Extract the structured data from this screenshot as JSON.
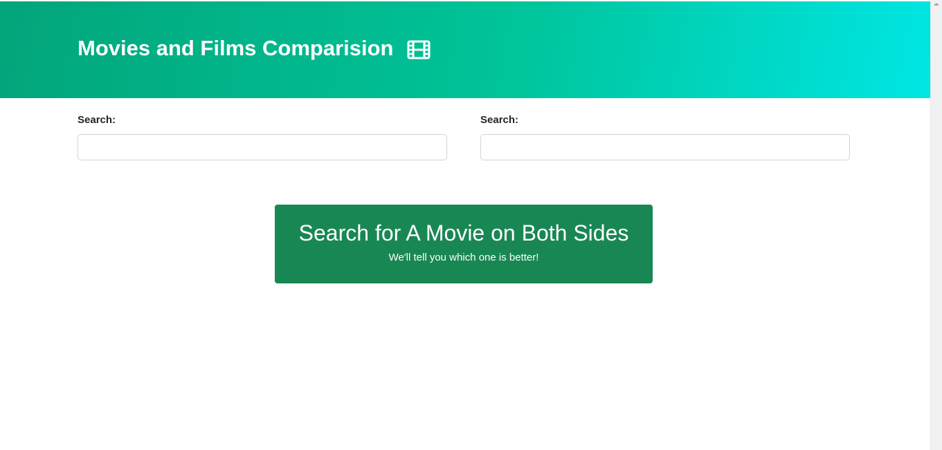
{
  "header": {
    "title": "Movies and Films Comparision",
    "icon": "film-icon"
  },
  "search": {
    "left": {
      "label": "Search:",
      "value": "",
      "placeholder": ""
    },
    "right": {
      "label": "Search:",
      "value": "",
      "placeholder": ""
    }
  },
  "cta": {
    "title": "Search for A Movie on Both Sides",
    "subtitle": "We'll tell you which one is better!"
  },
  "colors": {
    "hero_gradient_start": "#03a57a",
    "hero_gradient_end": "#00e6e4",
    "cta_background": "#198754",
    "text_dark": "#212529"
  }
}
